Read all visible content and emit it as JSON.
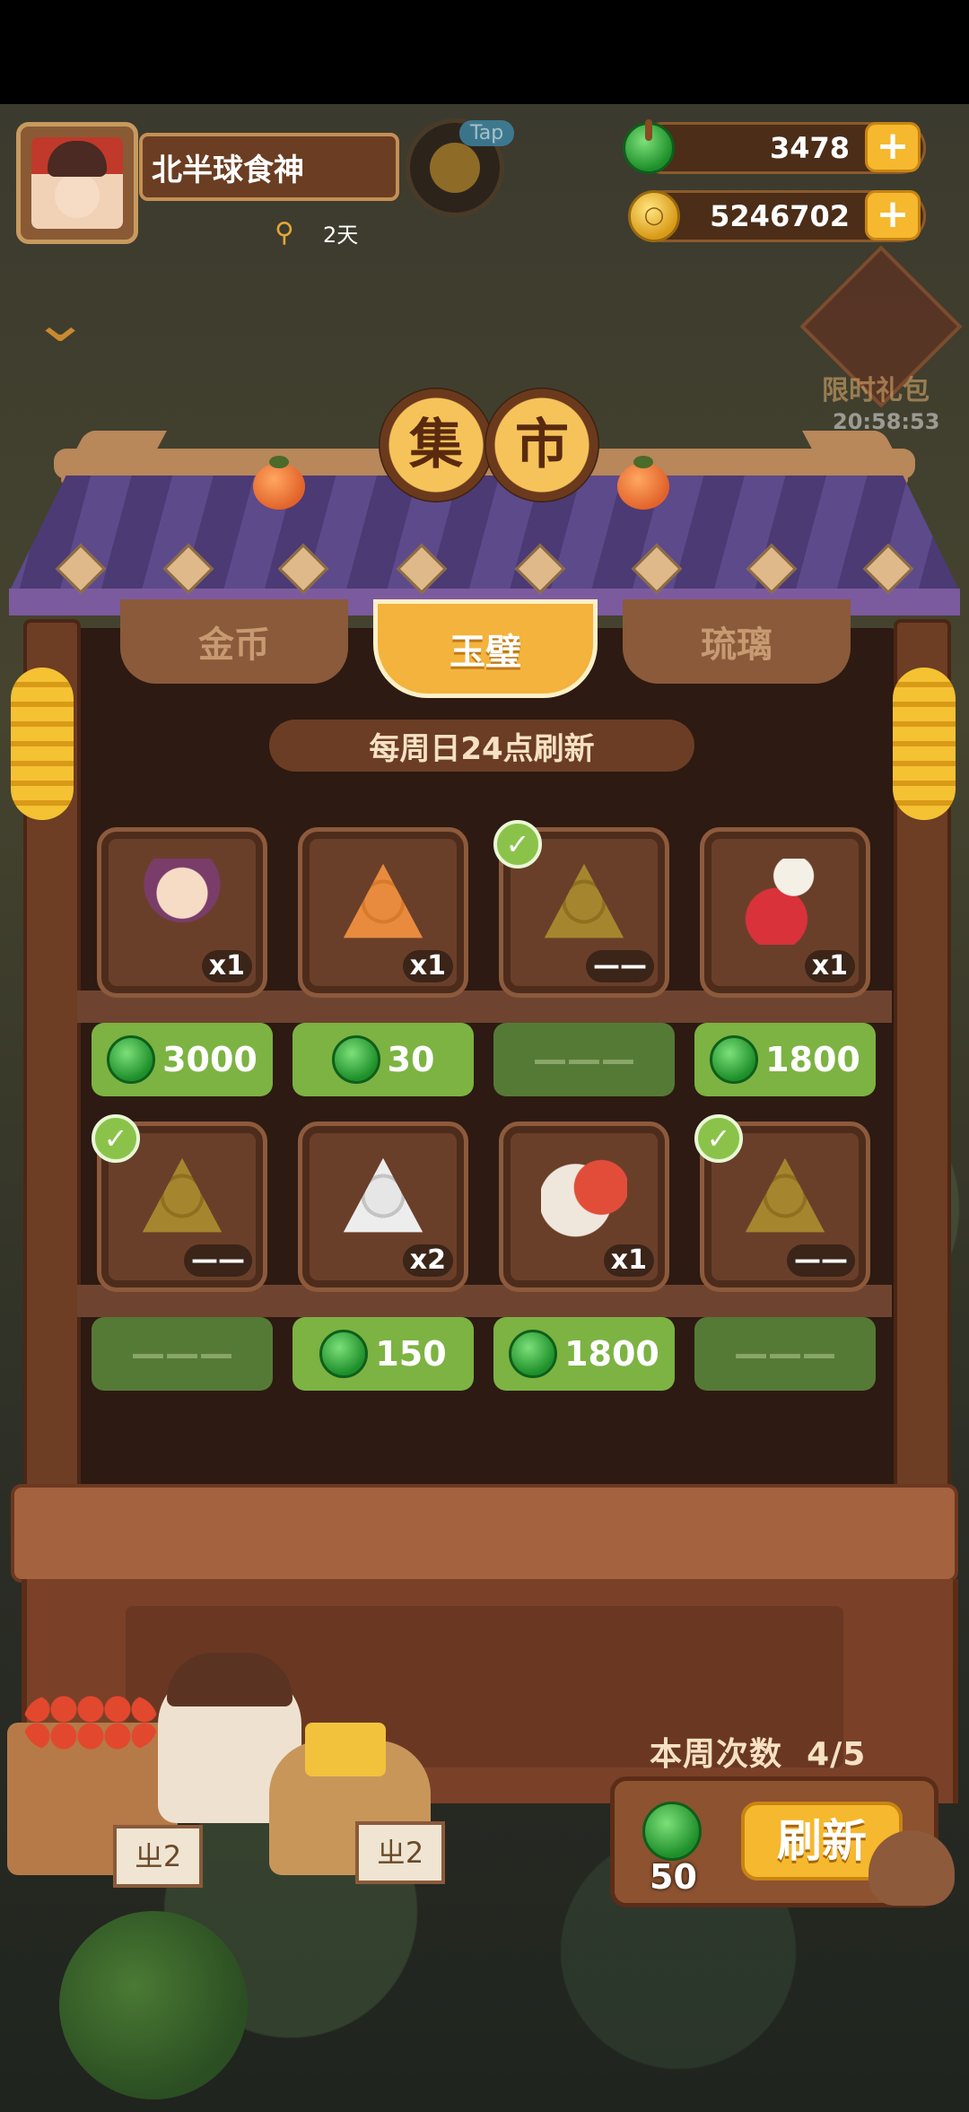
{
  "player": {
    "name": "北半球食神",
    "days": "2天",
    "tap_label": "Tap"
  },
  "currency": {
    "jade": "3478",
    "coins": "5246702",
    "coin_glyph": "○",
    "plus": "+"
  },
  "limited_gift": {
    "label": "限时礼包",
    "timer": "20:58:53"
  },
  "title": {
    "char1": "集",
    "char2": "市"
  },
  "tabs": [
    {
      "label": "金币",
      "active": false
    },
    {
      "label": "玉璧",
      "active": true
    },
    {
      "label": "琉璃",
      "active": false
    }
  ],
  "refresh_note": "每周日24点刷新",
  "items": [
    {
      "art": "character",
      "qty": "x1",
      "price": "3000",
      "sold": false
    },
    {
      "art": "triangle-orange",
      "qty": "x1",
      "price": "30",
      "sold": false
    },
    {
      "art": "triangle-olive",
      "qty": "——",
      "price": "———",
      "sold": true
    },
    {
      "art": "bird-flower",
      "qty": "x1",
      "price": "1800",
      "sold": false
    },
    {
      "art": "triangle-olive",
      "qty": "——",
      "price": "———",
      "sold": true
    },
    {
      "art": "triangle-white",
      "qty": "x2",
      "price": "150",
      "sold": false
    },
    {
      "art": "porcelain-jar",
      "qty": "x1",
      "price": "1800",
      "sold": false
    },
    {
      "art": "triangle-olive",
      "qty": "——",
      "price": "———",
      "sold": true
    }
  ],
  "check_glyph": "✓",
  "refresh": {
    "week_label": "本周次数",
    "week_count": "4/5",
    "cost": "50",
    "button": "刷新"
  },
  "vendor_tags": {
    "left": "ㄓ2",
    "right": "ㄓ2"
  },
  "colors": {
    "jade_green": "#7cb342",
    "gold": "#f5b82e",
    "roof_purple": "#5d4a8a",
    "wood": "#6d3d24"
  }
}
